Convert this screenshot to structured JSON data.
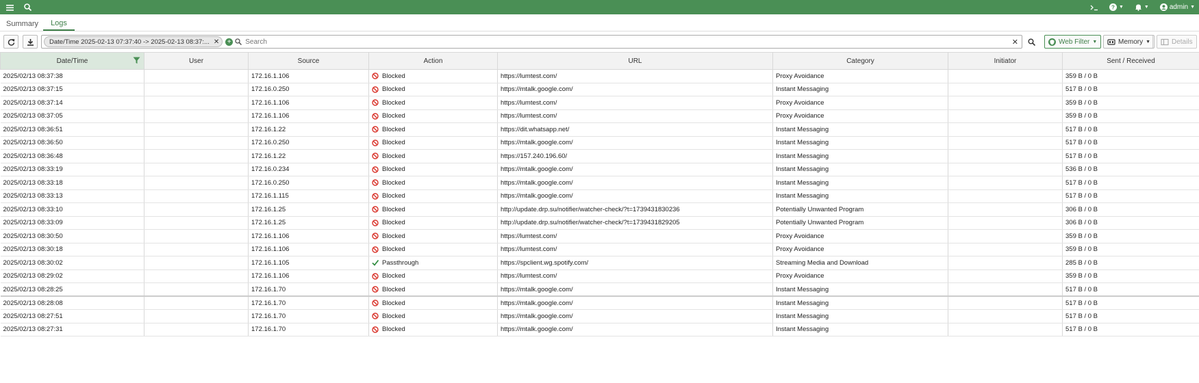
{
  "topbar": {
    "user": "admin"
  },
  "tabs": [
    {
      "label": "Summary",
      "active": false
    },
    {
      "label": "Logs",
      "active": true
    }
  ],
  "toolbar": {
    "filter_chip": "Date/Time 2025-02-13 07:37:40 -> 2025-02-13 08:37:...",
    "search_placeholder": "Search",
    "web_filter": "Web Filter",
    "memory": "Memory",
    "details": "Details"
  },
  "columns": [
    "Date/Time",
    "User",
    "Source",
    "Action",
    "URL",
    "Category",
    "Initiator",
    "Sent / Received"
  ],
  "rows": [
    {
      "time": "2025/02/13 08:37:38",
      "user": "",
      "source": "172.16.1.106",
      "action": "Blocked",
      "url": "https://lumtest.com/",
      "category": "Proxy Avoidance",
      "initiator": "",
      "sent": "359 B / 0 B"
    },
    {
      "time": "2025/02/13 08:37:15",
      "user": "",
      "source": "172.16.0.250",
      "action": "Blocked",
      "url": "https://mtalk.google.com/",
      "category": "Instant Messaging",
      "initiator": "",
      "sent": "517 B / 0 B"
    },
    {
      "time": "2025/02/13 08:37:14",
      "user": "",
      "source": "172.16.1.106",
      "action": "Blocked",
      "url": "https://lumtest.com/",
      "category": "Proxy Avoidance",
      "initiator": "",
      "sent": "359 B / 0 B"
    },
    {
      "time": "2025/02/13 08:37:05",
      "user": "",
      "source": "172.16.1.106",
      "action": "Blocked",
      "url": "https://lumtest.com/",
      "category": "Proxy Avoidance",
      "initiator": "",
      "sent": "359 B / 0 B"
    },
    {
      "time": "2025/02/13 08:36:51",
      "user": "",
      "source": "172.16.1.22",
      "action": "Blocked",
      "url": "https://dit.whatsapp.net/",
      "category": "Instant Messaging",
      "initiator": "",
      "sent": "517 B / 0 B"
    },
    {
      "time": "2025/02/13 08:36:50",
      "user": "",
      "source": "172.16.0.250",
      "action": "Blocked",
      "url": "https://mtalk.google.com/",
      "category": "Instant Messaging",
      "initiator": "",
      "sent": "517 B / 0 B"
    },
    {
      "time": "2025/02/13 08:36:48",
      "user": "",
      "source": "172.16.1.22",
      "action": "Blocked",
      "url": "https://157.240.196.60/",
      "category": "Instant Messaging",
      "initiator": "",
      "sent": "517 B / 0 B"
    },
    {
      "time": "2025/02/13 08:33:19",
      "user": "",
      "source": "172.16.0.234",
      "action": "Blocked",
      "url": "https://mtalk.google.com/",
      "category": "Instant Messaging",
      "initiator": "",
      "sent": "536 B / 0 B"
    },
    {
      "time": "2025/02/13 08:33:18",
      "user": "",
      "source": "172.16.0.250",
      "action": "Blocked",
      "url": "https://mtalk.google.com/",
      "category": "Instant Messaging",
      "initiator": "",
      "sent": "517 B / 0 B"
    },
    {
      "time": "2025/02/13 08:33:13",
      "user": "",
      "source": "172.16.1.115",
      "action": "Blocked",
      "url": "https://mtalk.google.com/",
      "category": "Instant Messaging",
      "initiator": "",
      "sent": "517 B / 0 B"
    },
    {
      "time": "2025/02/13 08:33:10",
      "user": "",
      "source": "172.16.1.25",
      "action": "Blocked",
      "url": "http://update.drp.su/notifier/watcher-check/?t=1739431830236",
      "category": "Potentially Unwanted Program",
      "initiator": "",
      "sent": "306 B / 0 B"
    },
    {
      "time": "2025/02/13 08:33:09",
      "user": "",
      "source": "172.16.1.25",
      "action": "Blocked",
      "url": "http://update.drp.su/notifier/watcher-check/?t=1739431829205",
      "category": "Potentially Unwanted Program",
      "initiator": "",
      "sent": "306 B / 0 B"
    },
    {
      "time": "2025/02/13 08:30:50",
      "user": "",
      "source": "172.16.1.106",
      "action": "Blocked",
      "url": "https://lumtest.com/",
      "category": "Proxy Avoidance",
      "initiator": "",
      "sent": "359 B / 0 B"
    },
    {
      "time": "2025/02/13 08:30:18",
      "user": "",
      "source": "172.16.1.106",
      "action": "Blocked",
      "url": "https://lumtest.com/",
      "category": "Proxy Avoidance",
      "initiator": "",
      "sent": "359 B / 0 B"
    },
    {
      "time": "2025/02/13 08:30:02",
      "user": "",
      "source": "172.16.1.105",
      "action": "Passthrough",
      "url": "https://spclient.wg.spotify.com/",
      "category": "Streaming Media and Download",
      "initiator": "",
      "sent": "285 B / 0 B"
    },
    {
      "time": "2025/02/13 08:29:02",
      "user": "",
      "source": "172.16.1.106",
      "action": "Blocked",
      "url": "https://lumtest.com/",
      "category": "Proxy Avoidance",
      "initiator": "",
      "sent": "359 B / 0 B"
    },
    {
      "time": "2025/02/13 08:28:25",
      "user": "",
      "source": "172.16.1.70",
      "action": "Blocked",
      "url": "https://mtalk.google.com/",
      "category": "Instant Messaging",
      "initiator": "",
      "sent": "517 B / 0 B"
    },
    {
      "time": "2025/02/13 08:28:08",
      "user": "",
      "source": "172.16.1.70",
      "action": "Blocked",
      "url": "https://mtalk.google.com/",
      "category": "Instant Messaging",
      "initiator": "",
      "sent": "517 B / 0 B"
    },
    {
      "time": "2025/02/13 08:27:51",
      "user": "",
      "source": "172.16.1.70",
      "action": "Blocked",
      "url": "https://mtalk.google.com/",
      "category": "Instant Messaging",
      "initiator": "",
      "sent": "517 B / 0 B"
    },
    {
      "time": "2025/02/13 08:27:31",
      "user": "",
      "source": "172.16.1.70",
      "action": "Blocked",
      "url": "https://mtalk.google.com/",
      "category": "Instant Messaging",
      "initiator": "",
      "sent": "517 B / 0 B"
    }
  ],
  "colors": {
    "brand": "#4a8f55",
    "blocked": "#d9342b",
    "pass": "#2e8b3e"
  }
}
